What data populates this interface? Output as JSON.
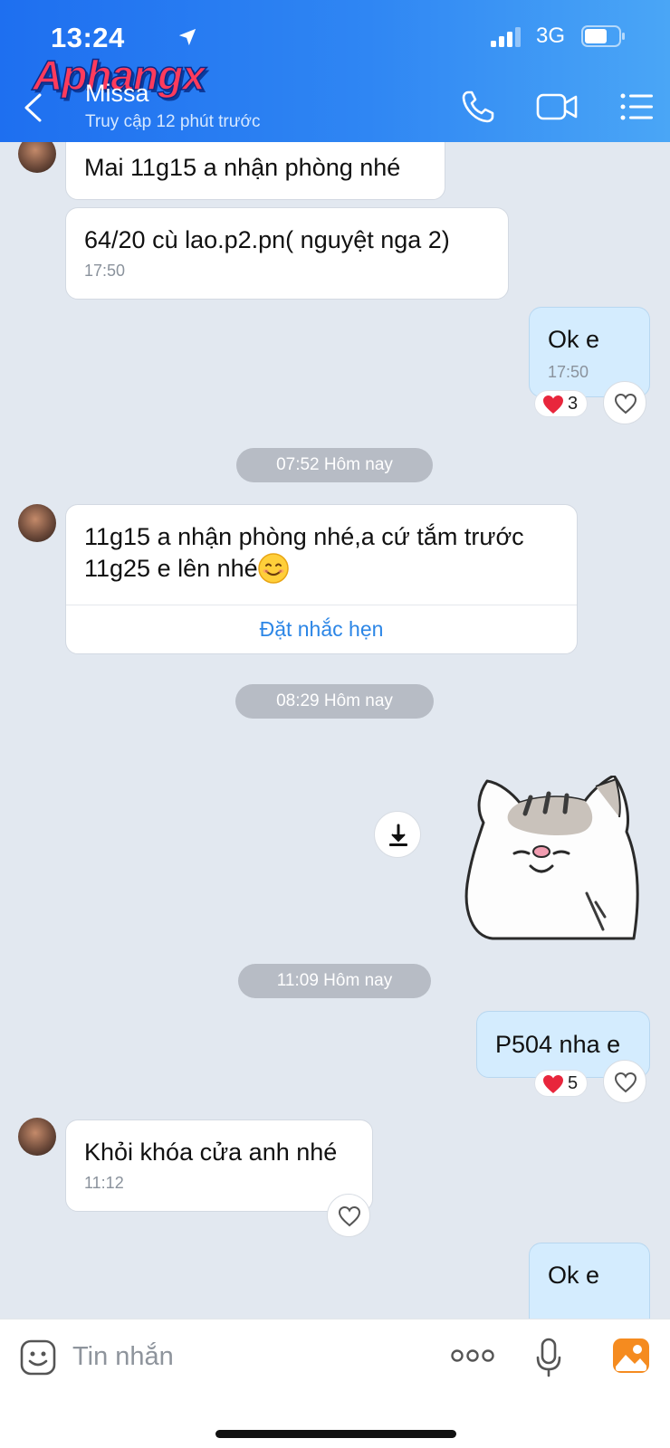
{
  "status_bar": {
    "time": "13:24",
    "network": "3G"
  },
  "watermark": "Aphangx",
  "header": {
    "contact_name": "Missa",
    "last_seen": "Truy cập 12 phút trước"
  },
  "messages": [
    {
      "dir": "in",
      "text": "Mai 11g15  a nhận phòng nhé"
    },
    {
      "dir": "in",
      "text": "64/20 cù lao.p2.pn( nguyệt nga 2)",
      "time": "17:50"
    },
    {
      "dir": "out",
      "text": "Ok e",
      "time": "17:50",
      "reactions": 3
    },
    {
      "separator": "07:52 Hôm nay"
    },
    {
      "dir": "in",
      "text_line1": "11g15 a nhận phòng nhé,a cứ tắm trước",
      "text_line2": "11g25 e lên nhé",
      "action": "Đặt nhắc hẹn"
    },
    {
      "separator": "08:29 Hôm nay"
    },
    {
      "dir": "out",
      "type": "sticker",
      "description": "cat-sticker"
    },
    {
      "separator": "11:09 Hôm nay"
    },
    {
      "dir": "out",
      "text": "P504 nha e",
      "reactions": 5
    },
    {
      "dir": "in",
      "text": "Khỏi khóa cửa anh nhé",
      "time": "11:12"
    },
    {
      "dir": "out",
      "text": "Ok e"
    }
  ],
  "composer": {
    "placeholder": "Tin nhắn"
  },
  "colors": {
    "header_start": "#1e6ff0",
    "header_end": "#4aa6f6",
    "chat_bg": "#e2e8f0",
    "outgoing": "#d4ecfe",
    "accent": "#2c86e6",
    "heart": "#e8263c"
  }
}
